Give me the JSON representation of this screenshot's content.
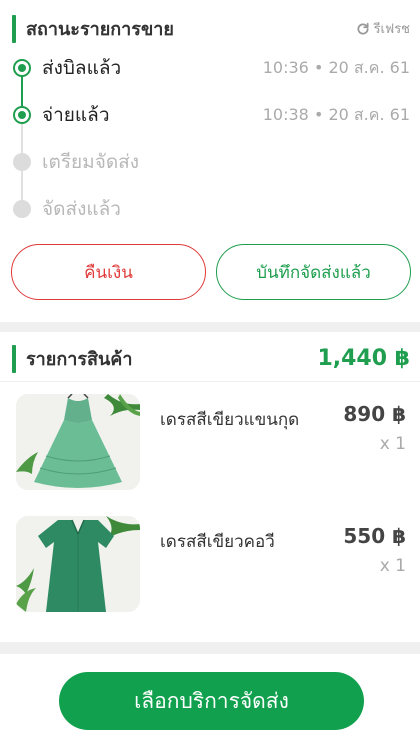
{
  "status": {
    "title": "สถานะรายการขาย",
    "refresh_label": "รีเฟรช",
    "steps": [
      {
        "label": "ส่งบิลแล้ว",
        "time": "10:36 • 20 ส.ค. 61",
        "state": "done"
      },
      {
        "label": "จ่ายแล้ว",
        "time": "10:38 • 20 ส.ค. 61",
        "state": "done"
      },
      {
        "label": "เตรียมจัดส่ง",
        "time": "",
        "state": "pending"
      },
      {
        "label": "จัดส่งแล้ว",
        "time": "",
        "state": "pending"
      }
    ],
    "refund_label": "คืนเงิน",
    "mark_shipped_label": "บันทึกจัดส่งแล้ว"
  },
  "items": {
    "title": "รายการสินค้า",
    "total": "1,440 ฿",
    "products": [
      {
        "name": "เดรสสีเขียวแขนกุด",
        "price": "890 ฿",
        "qty": "x 1",
        "image": "green-sleeveless-dress"
      },
      {
        "name": "เดรสสีเขียวคอวี",
        "price": "550 ฿",
        "qty": "x 1",
        "image": "green-v-neck-dress"
      }
    ]
  },
  "footer": {
    "cta_label": "เลือกบริการจัดส่ง"
  },
  "colors": {
    "accent_green": "#1e9e4e",
    "refund_red": "#e03b3b",
    "cta_green": "#11a14e"
  }
}
